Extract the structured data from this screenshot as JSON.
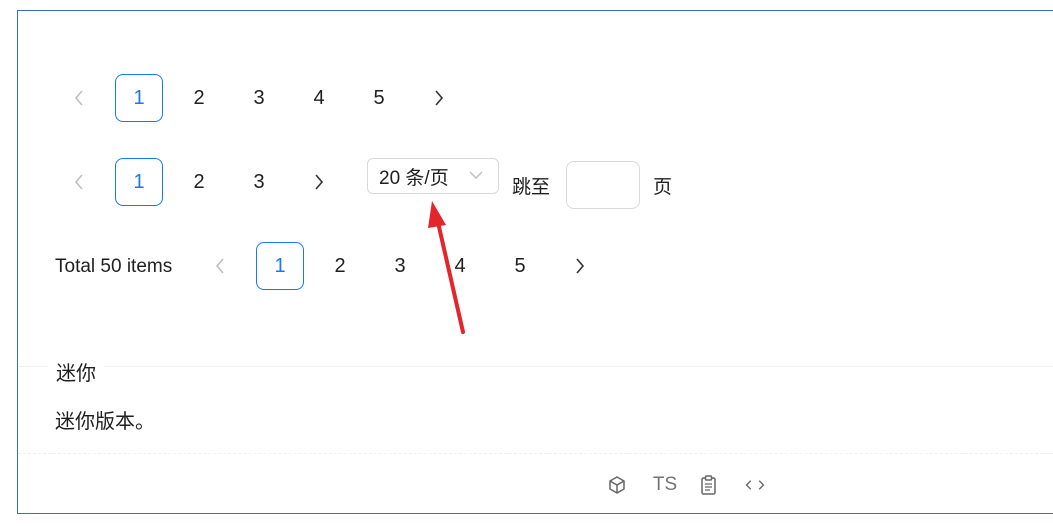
{
  "pagination_basic": {
    "prev_icon": "chevron-left-icon",
    "next_icon": "chevron-right-icon",
    "pages": [
      "1",
      "2",
      "3",
      "4",
      "5"
    ],
    "current": "1"
  },
  "pagination_changer": {
    "pages": [
      "1",
      "2",
      "3"
    ],
    "current": "1",
    "page_size": "20 条/页",
    "jumper_prefix": "跳至",
    "jumper_suffix": "页",
    "jumper_value": ""
  },
  "pagination_total": {
    "total_text": "Total 50 items",
    "pages": [
      "1",
      "2",
      "3",
      "4",
      "5"
    ],
    "current": "1"
  },
  "section": {
    "title": "迷你",
    "description": "迷你版本。"
  },
  "actions": {
    "codesandbox_icon": "codesandbox-icon",
    "ts_label": "TS",
    "copy_icon": "copy-icon",
    "code_icon": "code-icon"
  },
  "colors": {
    "primary": "#1677ff",
    "card_border": "#2f6fd0",
    "annotation_arrow": "#e3262b"
  }
}
